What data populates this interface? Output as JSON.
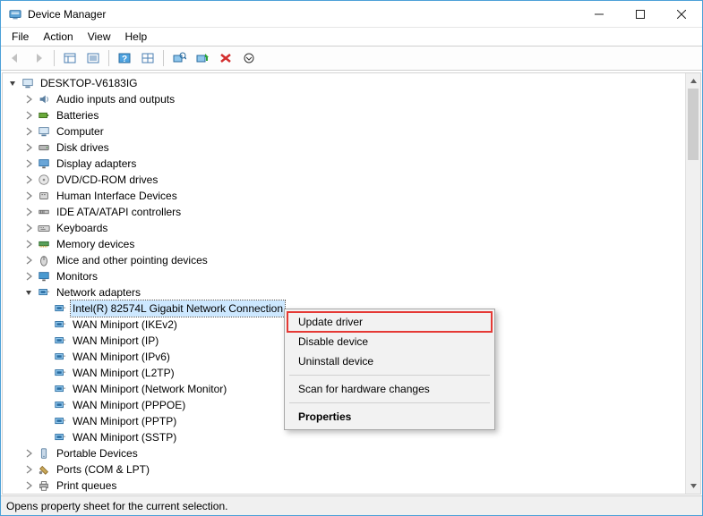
{
  "window": {
    "title": "Device Manager"
  },
  "menubar": {
    "file": "File",
    "action": "Action",
    "view": "View",
    "help": "Help"
  },
  "toolbar_icons": {
    "back": "back-icon",
    "forward": "forward-icon",
    "show_hidden": "show-hidden-icon",
    "properties": "properties-icon",
    "help": "help-icon",
    "scan": "scan-hardware-icon",
    "enable": "enable-device-icon",
    "update": "update-driver-icon",
    "uninstall": "uninstall-icon",
    "view_menu": "view-menu-icon"
  },
  "tree": {
    "root": "DESKTOP-V6183IG",
    "categories": [
      {
        "label": "Audio inputs and outputs",
        "icon": "audio"
      },
      {
        "label": "Batteries",
        "icon": "battery"
      },
      {
        "label": "Computer",
        "icon": "computer"
      },
      {
        "label": "Disk drives",
        "icon": "disk"
      },
      {
        "label": "Display adapters",
        "icon": "display"
      },
      {
        "label": "DVD/CD-ROM drives",
        "icon": "dvd"
      },
      {
        "label": "Human Interface Devices",
        "icon": "hid"
      },
      {
        "label": "IDE ATA/ATAPI controllers",
        "icon": "ide"
      },
      {
        "label": "Keyboards",
        "icon": "keyboard"
      },
      {
        "label": "Memory devices",
        "icon": "memory"
      },
      {
        "label": "Mice and other pointing devices",
        "icon": "mouse"
      },
      {
        "label": "Monitors",
        "icon": "monitor"
      },
      {
        "label": "Network adapters",
        "icon": "network",
        "expanded": true,
        "children": [
          {
            "label": "Intel(R) 82574L Gigabit Network Connection",
            "selected": true
          },
          {
            "label": "WAN Miniport (IKEv2)"
          },
          {
            "label": "WAN Miniport (IP)"
          },
          {
            "label": "WAN Miniport (IPv6)"
          },
          {
            "label": "WAN Miniport (L2TP)"
          },
          {
            "label": "WAN Miniport (Network Monitor)"
          },
          {
            "label": "WAN Miniport (PPPOE)"
          },
          {
            "label": "WAN Miniport (PPTP)"
          },
          {
            "label": "WAN Miniport (SSTP)"
          }
        ]
      },
      {
        "label": "Portable Devices",
        "icon": "portable"
      },
      {
        "label": "Ports (COM & LPT)",
        "icon": "ports"
      },
      {
        "label": "Print queues",
        "icon": "print"
      }
    ]
  },
  "context_menu": {
    "update": "Update driver",
    "disable": "Disable device",
    "uninstall": "Uninstall device",
    "scan": "Scan for hardware changes",
    "properties": "Properties"
  },
  "statusbar": {
    "text": "Opens property sheet for the current selection."
  }
}
